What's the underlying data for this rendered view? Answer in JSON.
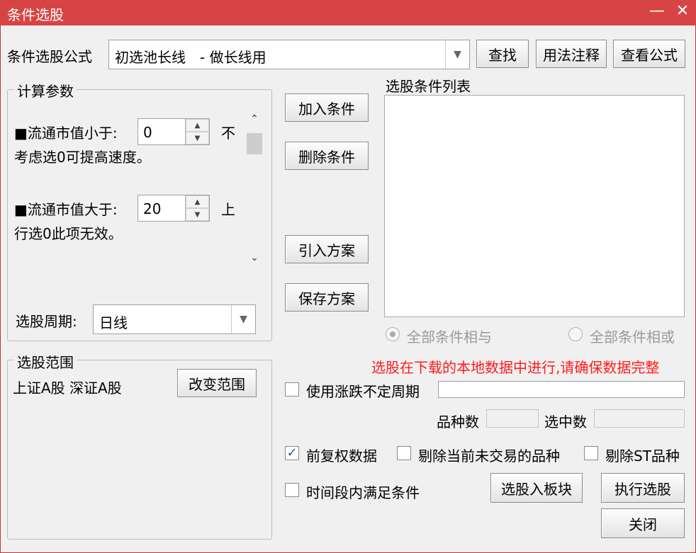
{
  "window": {
    "title": "条件选股",
    "minimize": "—",
    "close": "✕"
  },
  "formula": {
    "label": "条件选股公式",
    "value": "初选池长线　- 做长线用",
    "find_btn": "查找",
    "usage_btn": "用法注释",
    "view_btn": "查看公式"
  },
  "params": {
    "legend": "计算参数",
    "row1": {
      "label": "■流通市值小于:",
      "value": "0",
      "suffix": "不",
      "note": "考虑选0可提高速度。"
    },
    "row2": {
      "label": "■流通市值大于:",
      "value": "20",
      "suffix": "上",
      "note": "行选0此项无效。"
    },
    "period_label": "选股周期:",
    "period_value": "日线"
  },
  "scope": {
    "legend": "选股范围",
    "value": "上证A股 深证A股",
    "change_btn": "改变范围"
  },
  "middle": {
    "add_btn": "加入条件",
    "delete_btn": "删除条件",
    "import_btn": "引入方案",
    "save_btn": "保存方案"
  },
  "conditions": {
    "label": "选股条件列表",
    "radio_and": "全部条件相与",
    "radio_or": "全部条件相或"
  },
  "warning": "选股在下载的本地数据中进行,请确保数据完整",
  "options": {
    "irregular_period": "使用涨跌不定周期",
    "count_label": "品种数",
    "selected_label": "选中数",
    "forward_adjust": "前复权数据",
    "forward_adjust_checked": true,
    "exclude_untraded": "剔除当前未交易的品种",
    "exclude_st": "剔除ST品种",
    "time_period": "时间段内满足条件"
  },
  "actions": {
    "to_board_btn": "选股入板块",
    "execute_btn": "执行选股",
    "close_btn": "关闭"
  },
  "icons": {
    "check": "✓",
    "spin_up": "▲",
    "spin_down": "▼",
    "scroll_up": "⌃",
    "scroll_down": "⌄",
    "combo": "▼"
  }
}
